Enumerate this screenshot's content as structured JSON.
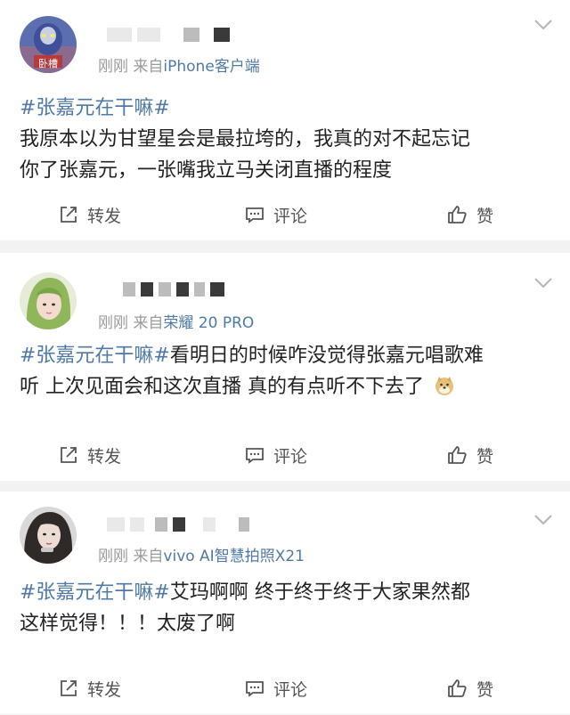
{
  "posts": [
    {
      "time": "刚刚",
      "from_prefix": "来自",
      "source": "iPhone客户端",
      "hashtag": "#张嘉元在干嘛#",
      "text_line1_rest": "",
      "body_line1": "我原本以为甘望星会是最拉垮的，我真的对不起忘记",
      "body_line2": "你了张嘉元，一张嘴我立马关闭直播的程度",
      "avatar_caption": "卧槽",
      "actions": {
        "share": "转发",
        "comment": "评论",
        "like": "赞"
      }
    },
    {
      "time": "刚刚",
      "from_prefix": "来自",
      "source": "荣耀 20 PRO",
      "hashtag": "#张嘉元在干嘛#",
      "body_line1_rest": "看明日的时候咋没觉得张嘉元唱歌难",
      "body_line2": "听  上次见面会和这次直播  真的有点听不下去了",
      "emoji": "doge-emoji",
      "actions": {
        "share": "转发",
        "comment": "评论",
        "like": "赞"
      }
    },
    {
      "time": "刚刚",
      "from_prefix": "来自",
      "source": "vivo AI智慧拍照X21",
      "hashtag": "#张嘉元在干嘛#",
      "body_line1_rest": "艾玛啊啊  终于终于终于大家果然都",
      "body_line2": "这样觉得！！！太废了啊",
      "actions": {
        "share": "转发",
        "comment": "评论",
        "like": "赞"
      }
    }
  ],
  "colors": {
    "link": "#4f7aa6",
    "meta": "#9a9a9a",
    "separator": "#f2f2f2"
  }
}
